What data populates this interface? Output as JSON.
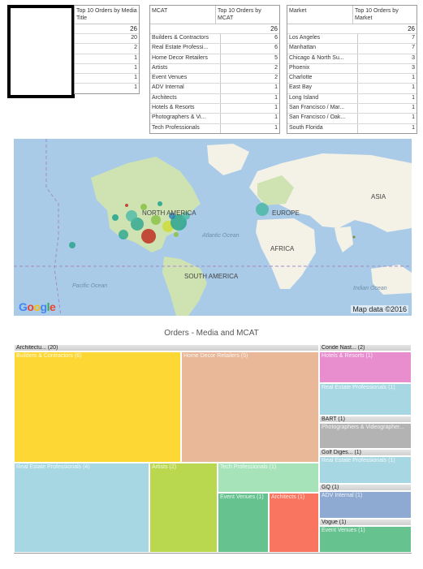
{
  "table_media": {
    "col1": "",
    "col2": "Top 10 Orders by Media Title",
    "total": "26",
    "rows": [
      {
        "name": "",
        "value": "20"
      },
      {
        "name": "",
        "value": "2"
      },
      {
        "name": "",
        "value": "1"
      },
      {
        "name": "",
        "value": "1"
      },
      {
        "name": "",
        "value": "1"
      },
      {
        "name": "",
        "value": "1"
      }
    ]
  },
  "table_mcat": {
    "col1": "MCAT",
    "col2": "Top 10 Orders by MCAT",
    "total": "26",
    "rows": [
      {
        "name": "Builders & Contractors",
        "value": "6"
      },
      {
        "name": "Real Estate Professi...",
        "value": "6"
      },
      {
        "name": "Home Decor Retailers",
        "value": "5"
      },
      {
        "name": "Artists",
        "value": "2"
      },
      {
        "name": "Event Venues",
        "value": "2"
      },
      {
        "name": "ADV Internal",
        "value": "1"
      },
      {
        "name": "Architects",
        "value": "1"
      },
      {
        "name": "Hotels & Resorts",
        "value": "1"
      },
      {
        "name": "Photographers & Vi...",
        "value": "1"
      },
      {
        "name": "Tech Professionals",
        "value": "1"
      }
    ]
  },
  "table_market": {
    "col1": "Market",
    "col2": "Top 10 Orders by Market",
    "total": "26",
    "rows": [
      {
        "name": "Los Angeles",
        "value": "7"
      },
      {
        "name": "Manhattan",
        "value": "7"
      },
      {
        "name": "Chicago & North Su...",
        "value": "3"
      },
      {
        "name": "Phoenix",
        "value": "3"
      },
      {
        "name": "Charlotte",
        "value": "1"
      },
      {
        "name": "East Bay",
        "value": "1"
      },
      {
        "name": "Long Island",
        "value": "1"
      },
      {
        "name": "San Francisco / Mar...",
        "value": "1"
      },
      {
        "name": "San Francisco / Oak...",
        "value": "1"
      },
      {
        "name": "South Florida",
        "value": "1"
      }
    ]
  },
  "map": {
    "labels": {
      "north_america": "NORTH AMERICA",
      "europe": "EUROPE",
      "asia": "ASIA",
      "africa": "AFRICA",
      "south_america": "SOUTH AMERICA",
      "atlantic": "Atlantic Ocean",
      "pacific": "Pacific Ocean",
      "indian": "Indian Ocean"
    },
    "logo": "Google",
    "attribution": "Map data ©2016",
    "colors": {
      "water": "#a9cbe8",
      "land": "#f4f1e6",
      "green": "#cfe3b2"
    }
  },
  "treemap": {
    "title": "Orders - Media and MCAT",
    "groups": [
      {
        "label": "Architectu... (20)"
      },
      {
        "label": "Conde Nast... (2)"
      },
      {
        "label": "BART (1)"
      },
      {
        "label": "Golf Diges... (1)"
      },
      {
        "label": "GQ (1)"
      },
      {
        "label": "Vogue (1)"
      }
    ],
    "cells": [
      {
        "label": "Builders & Contractors (6)",
        "color": "#fdd835"
      },
      {
        "label": "Home Decor Retailers (5)",
        "color": "#e8b898"
      },
      {
        "label": "Real Estate Professionals (4)",
        "color": "#a6d7e3"
      },
      {
        "label": "Artists (2)",
        "color": "#bad84f"
      },
      {
        "label": "Tech Professionals (1)",
        "color": "#a6e3b8"
      },
      {
        "label": "Event Venues (1)",
        "color": "#66c28f"
      },
      {
        "label": "Architects (1)",
        "color": "#f97560"
      },
      {
        "label": "Hotels & Resorts (1)",
        "color": "#e88dce"
      },
      {
        "label": "Real Estate Professionals (1)",
        "color": "#a6d7e3"
      },
      {
        "label": "Photographers & Videographer...",
        "color": "#b3b3b3"
      },
      {
        "label": "Real Estate Professionals (1)",
        "color": "#a6d7e3"
      },
      {
        "label": "ADV Internal (1)",
        "color": "#8eaad2"
      },
      {
        "label": "Event Venues (1)",
        "color": "#66c28f"
      }
    ]
  }
}
